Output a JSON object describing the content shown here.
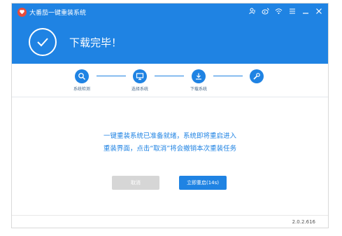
{
  "window": {
    "title": "大番茄一键重装系统",
    "icons": [
      "user-icon",
      "weibo-icon",
      "wifi-icon",
      "menu-icon",
      "minimize-icon",
      "close-icon"
    ]
  },
  "header": {
    "status_text": "下载完毕！"
  },
  "steps": [
    {
      "label": "系统检测",
      "icon": "search-icon"
    },
    {
      "label": "选择系统",
      "icon": "monitor-icon"
    },
    {
      "label": "下载系统",
      "icon": "download-icon"
    },
    {
      "label": "",
      "icon": "wrench-icon"
    }
  ],
  "message": {
    "line1": "一键重装系统已准备就绪，系统即将重启进入",
    "line2": "重装界面，点击“取消”将会撤销本次重装任务"
  },
  "buttons": {
    "cancel_label": "取消",
    "restart_label": "立即重启(14s)"
  },
  "footer": {
    "version": "2.0.2.616"
  },
  "colors": {
    "accent": "#1f83e3",
    "disabled": "#d6d6d6"
  }
}
